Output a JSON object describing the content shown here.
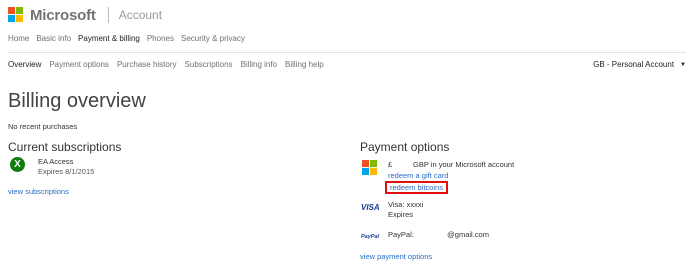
{
  "header": {
    "brand": "Microsoft",
    "section": "Account",
    "logo_colors": [
      "#f25022",
      "#7fba00",
      "#00a4ef",
      "#ffb900"
    ]
  },
  "nav_primary": [
    "Home",
    "Basic info",
    "Payment & billing",
    "Phones",
    "Security & privacy"
  ],
  "nav_secondary": [
    "Overview",
    "Payment options",
    "Purchase history",
    "Subscriptions",
    "Billing info",
    "Billing help"
  ],
  "account_selector": {
    "value": "GB - Personal Account",
    "caret": "▼"
  },
  "page": {
    "title": "Billing overview",
    "no_recent": "No recent purchases"
  },
  "subscriptions": {
    "heading": "Current subscriptions",
    "item_icon": "X",
    "item_name": "EA Access",
    "item_expires": "Expires 8/1/2015",
    "view_link": "view subscriptions"
  },
  "payment": {
    "heading": "Payment options",
    "gbp_line": "£          GBP in your Microsoft account",
    "redeem_gift": "redeem a gift card",
    "redeem_bitcoin": "redeem bitcoins",
    "visa_logo": "VISA",
    "visa_line": "Visa: xxxxi",
    "visa_expires": "Expires",
    "paypal_logo": "PayPal",
    "paypal_line": "PayPal:                @gmail.com",
    "view_link": "view payment options"
  },
  "colors": {
    "link": "#2b6cc4",
    "highlight_border": "#e01010",
    "xbox_green": "#107c10"
  }
}
